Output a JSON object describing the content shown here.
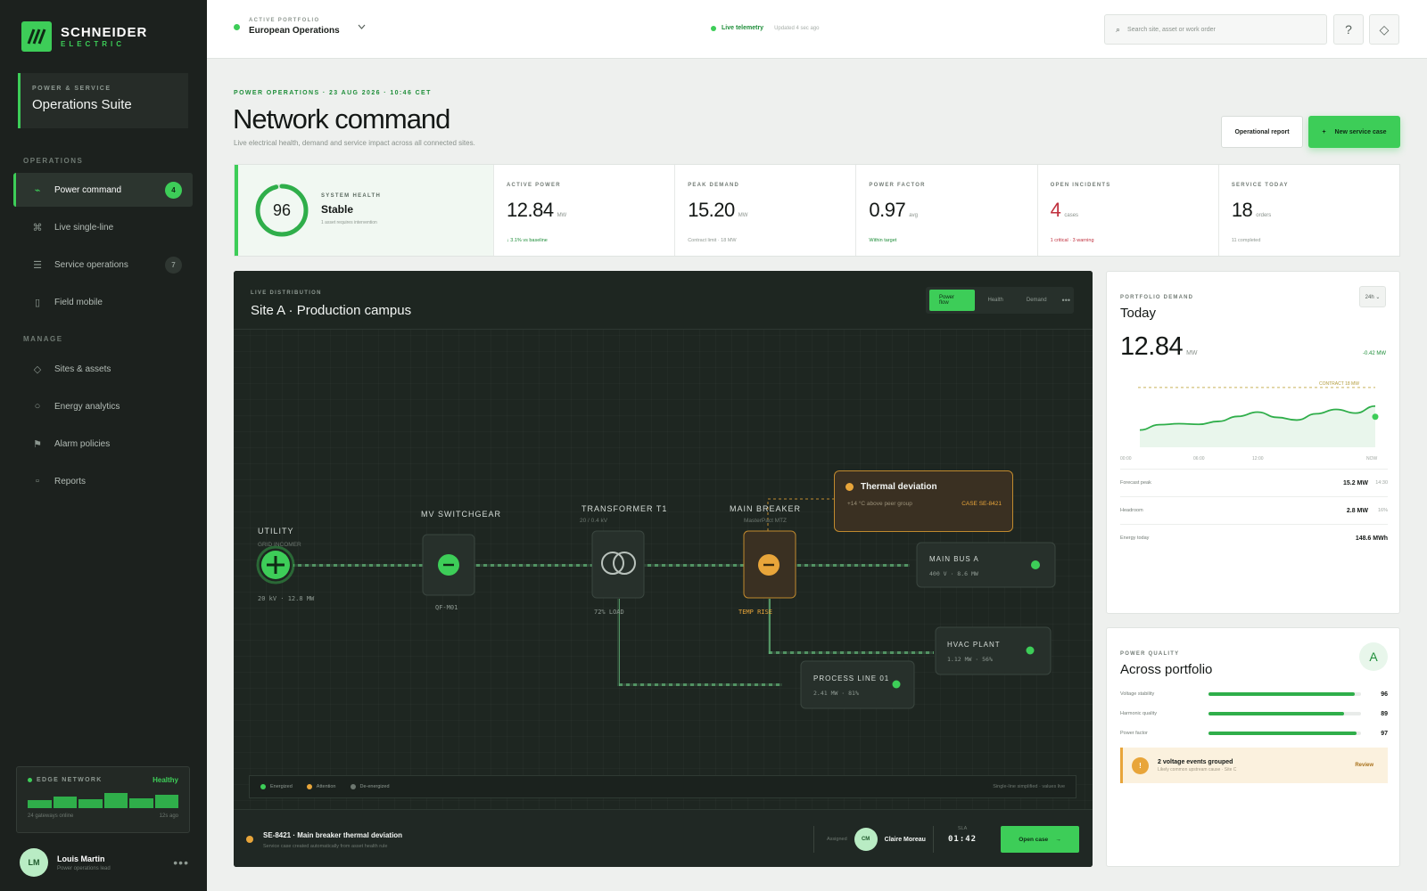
{
  "brand": {
    "name": "SCHNEIDER",
    "sub": "ELECTRIC"
  },
  "suite": {
    "eyebrow": "POWER & SERVICE",
    "title": "Operations Suite"
  },
  "sidebar": {
    "section_operations": "OPERATIONS",
    "section_manage": "MANAGE",
    "items": [
      {
        "label": "Power command",
        "icon": "bolt-icon",
        "badge": "4"
      },
      {
        "label": "Live single-line",
        "icon": "network-icon"
      },
      {
        "label": "Service operations",
        "icon": "list-icon",
        "badge": "7"
      },
      {
        "label": "Field mobile",
        "icon": "phone-icon"
      },
      {
        "label": "Sites & assets",
        "icon": "diamond-icon"
      },
      {
        "label": "Energy analytics",
        "icon": "circle-icon"
      },
      {
        "label": "Alarm policies",
        "icon": "flag-icon"
      },
      {
        "label": "Reports",
        "icon": "document-icon"
      }
    ]
  },
  "edge": {
    "label": "EDGE NETWORK",
    "status": "Healthy",
    "gateways": "24 gateways online",
    "updated": "12s ago",
    "bars": [
      0.45,
      0.65,
      0.5,
      0.85,
      0.55,
      0.75
    ]
  },
  "user": {
    "initials": "LM",
    "name": "Louis Martin",
    "role": "Power operations lead",
    "more": "•••"
  },
  "topbar": {
    "portfolio_eyebrow": "ACTIVE PORTFOLIO",
    "portfolio_name": "European Operations",
    "telemetry": "Live telemetry",
    "telemetry_updated": "Updated 4 sec ago",
    "search_placeholder": "Search site, asset or work order",
    "help": "?"
  },
  "header": {
    "eyebrow": "POWER OPERATIONS · 23 AUG 2026 · 10:46 CET",
    "title": "Network command",
    "subtitle": "Live electrical health, demand and service impact across all connected sites.",
    "report_button": "Operational report",
    "new_case_plus": "+",
    "new_case_button": "New service case"
  },
  "health": {
    "eyebrow": "SYSTEM HEALTH",
    "score": "96",
    "score_fraction": 0.96,
    "status": "Stable",
    "note": "1 asset requires intervention"
  },
  "kpis": [
    {
      "eyebrow": "ACTIVE POWER",
      "value": "12.84",
      "unit": "MW",
      "note": "↓ 3.1% vs baseline",
      "tone": "green"
    },
    {
      "eyebrow": "PEAK DEMAND",
      "value": "15.20",
      "unit": "MW",
      "note": "Contract limit · 18 MW",
      "tone": "muted"
    },
    {
      "eyebrow": "POWER FACTOR",
      "value": "0.97",
      "unit": "avg",
      "note": "Within target",
      "tone": "green"
    },
    {
      "eyebrow": "OPEN INCIDENTS",
      "value": "4",
      "unit": "cases",
      "note": "1 critical · 3 warning",
      "tone": "red"
    },
    {
      "eyebrow": "SERVICE TODAY",
      "value": "18",
      "unit": "orders",
      "note": "11 completed",
      "tone": "muted"
    }
  ],
  "distribution": {
    "eyebrow": "LIVE DISTRIBUTION",
    "title": "Site A · Production campus",
    "tabs": [
      "Power flow",
      "Health",
      "Demand"
    ],
    "more": "•••",
    "nodes": {
      "utility": {
        "title": "UTILITY",
        "sub": "GRID INCOMER",
        "reading": "20 kV · 12.8 MW"
      },
      "switchgear": {
        "title": "MV SWITCHGEAR",
        "tag": "QF-M01"
      },
      "transformer": {
        "title": "TRANSFORMER T1",
        "sub": "20 / 0.4 kV",
        "tag": "72% LOAD"
      },
      "breaker": {
        "title": "MAIN BREAKER",
        "sub": "MasterPact MTZ",
        "tag": "TEMP RISE"
      },
      "bus": {
        "title": "MAIN BUS A",
        "reading": "400 V · 8.6 MW"
      },
      "hvac": {
        "title": "HVAC PLANT",
        "reading": "1.12 MW · 56%"
      },
      "process": {
        "title": "PROCESS LINE 01",
        "reading": "2.41 MW · 81%"
      }
    },
    "tooltip": {
      "title": "Thermal deviation",
      "detail": "+14 °C above peer group",
      "case": "CASE SE-8421"
    },
    "legend": {
      "energized": "Energized",
      "attention": "Attention",
      "deenergized": "De-energized",
      "note": "Single-line simplified · values live"
    },
    "case": {
      "title": "SE-8421 · Main breaker thermal deviation",
      "subtitle": "Service case created automatically from asset health rule",
      "assigned_label": "Assigned",
      "assignee_initials": "CM",
      "assignee": "Claire Moreau",
      "sla_label": "SLA",
      "sla": "01:42",
      "open_button": "Open case",
      "open_arrow": "→"
    }
  },
  "demand_card": {
    "eyebrow": "PORTFOLIO DEMAND",
    "title": "Today",
    "range": "24h ⌄",
    "value": "12.84",
    "unit": "MW",
    "delta": "-0.42 MW",
    "rows": [
      {
        "label": "Forecast peak",
        "value": "15.2 MW",
        "time": "14:30"
      },
      {
        "label": "Headroom",
        "value": "2.8 MW",
        "time": "16%"
      },
      {
        "label": "Energy today",
        "value": "148.6 MWh",
        "time": ""
      }
    ]
  },
  "chart_data": {
    "type": "area",
    "x": [
      "00:00",
      "02:00",
      "04:00",
      "06:00",
      "08:00",
      "10:00",
      "12:00",
      "14:00",
      "16:00",
      "18:00",
      "20:00",
      "22:00",
      "NOW"
    ],
    "values": [
      5.2,
      6.8,
      7.1,
      6.9,
      7.8,
      9.3,
      10.6,
      9.0,
      8.2,
      10.1,
      11.4,
      10.3,
      12.4
    ],
    "xticks": [
      "00:00",
      "06:00",
      "12:00",
      "NOW"
    ],
    "reference": {
      "label": "CONTRACT 18 MW",
      "value": 18
    },
    "ylim": [
      0,
      22
    ],
    "grid": false
  },
  "quality_card": {
    "eyebrow": "POWER QUALITY",
    "title": "Across portfolio",
    "grade": "A",
    "rows": [
      {
        "label": "Voltage stability",
        "value": "96",
        "fraction": 0.96
      },
      {
        "label": "Harmonic quality",
        "value": "89",
        "fraction": 0.89
      },
      {
        "label": "Power factor",
        "value": "97",
        "fraction": 0.97
      }
    ],
    "alert": {
      "icon": "!",
      "title": "2 voltage events grouped",
      "subtitle": "Likely common upstream cause · Site C",
      "action": "Review"
    }
  },
  "colors": {
    "accent": "#3dcd58",
    "warning": "#e8a53a",
    "danger": "#c0303e",
    "sidebar": "#1c211e",
    "panel": "#1e2621"
  }
}
